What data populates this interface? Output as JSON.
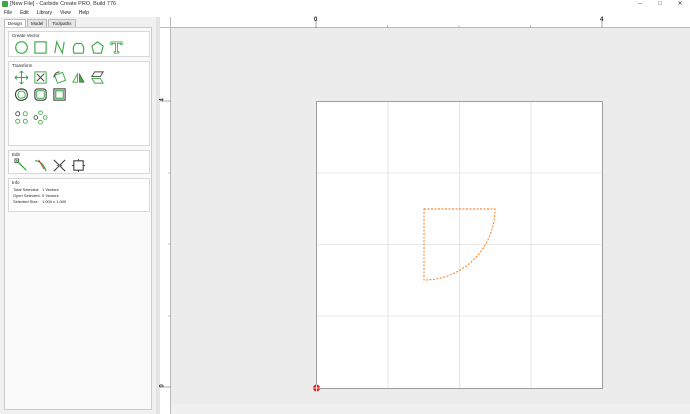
{
  "window": {
    "title": "[New File] - Carbide Create PRO, Build 776",
    "controls": {
      "minimize": "–",
      "maximize": "□",
      "close": "✕"
    }
  },
  "menu": [
    "File",
    "Edit",
    "Library",
    "View",
    "Help"
  ],
  "tabs": [
    {
      "label": "Design",
      "active": true
    },
    {
      "label": "Model",
      "active": false
    },
    {
      "label": "Toolpaths",
      "active": false
    }
  ],
  "sections": {
    "create_vector": "Create Vector",
    "transform": "Transform",
    "edit": "Edit",
    "info": "Info"
  },
  "tool_icons": {
    "create_vector": [
      "circle-icon",
      "rectangle-icon",
      "polyline-icon",
      "curve-icon",
      "polygon-icon",
      "text-icon"
    ],
    "transform": [
      "move-icon",
      "scale-icon",
      "rotate-icon",
      "mirror-icon",
      "skew-icon",
      "offset-icon",
      "join-icon",
      "boolean-icon",
      "array-icon",
      "circular-array-icon"
    ],
    "edit": [
      "node-edit-icon",
      "trim-icon",
      "cut-icon",
      "boundary-icon"
    ]
  },
  "info": {
    "total_selected_label": "Total Selected:",
    "total_selected_value": "1 Vectors",
    "open_selected_label": "Open Selected:",
    "open_selected_value": "0 Vectors",
    "selected_size_label": "Selected Size:",
    "selected_size_value": "1.000 x 1.000"
  },
  "rulers": {
    "top_labels": [
      "0",
      "4"
    ],
    "left_labels": [
      "4",
      "0"
    ]
  },
  "colors": {
    "accent": "#3aa845",
    "selection": "#ff6a00",
    "grid": "#cfcfcf"
  }
}
